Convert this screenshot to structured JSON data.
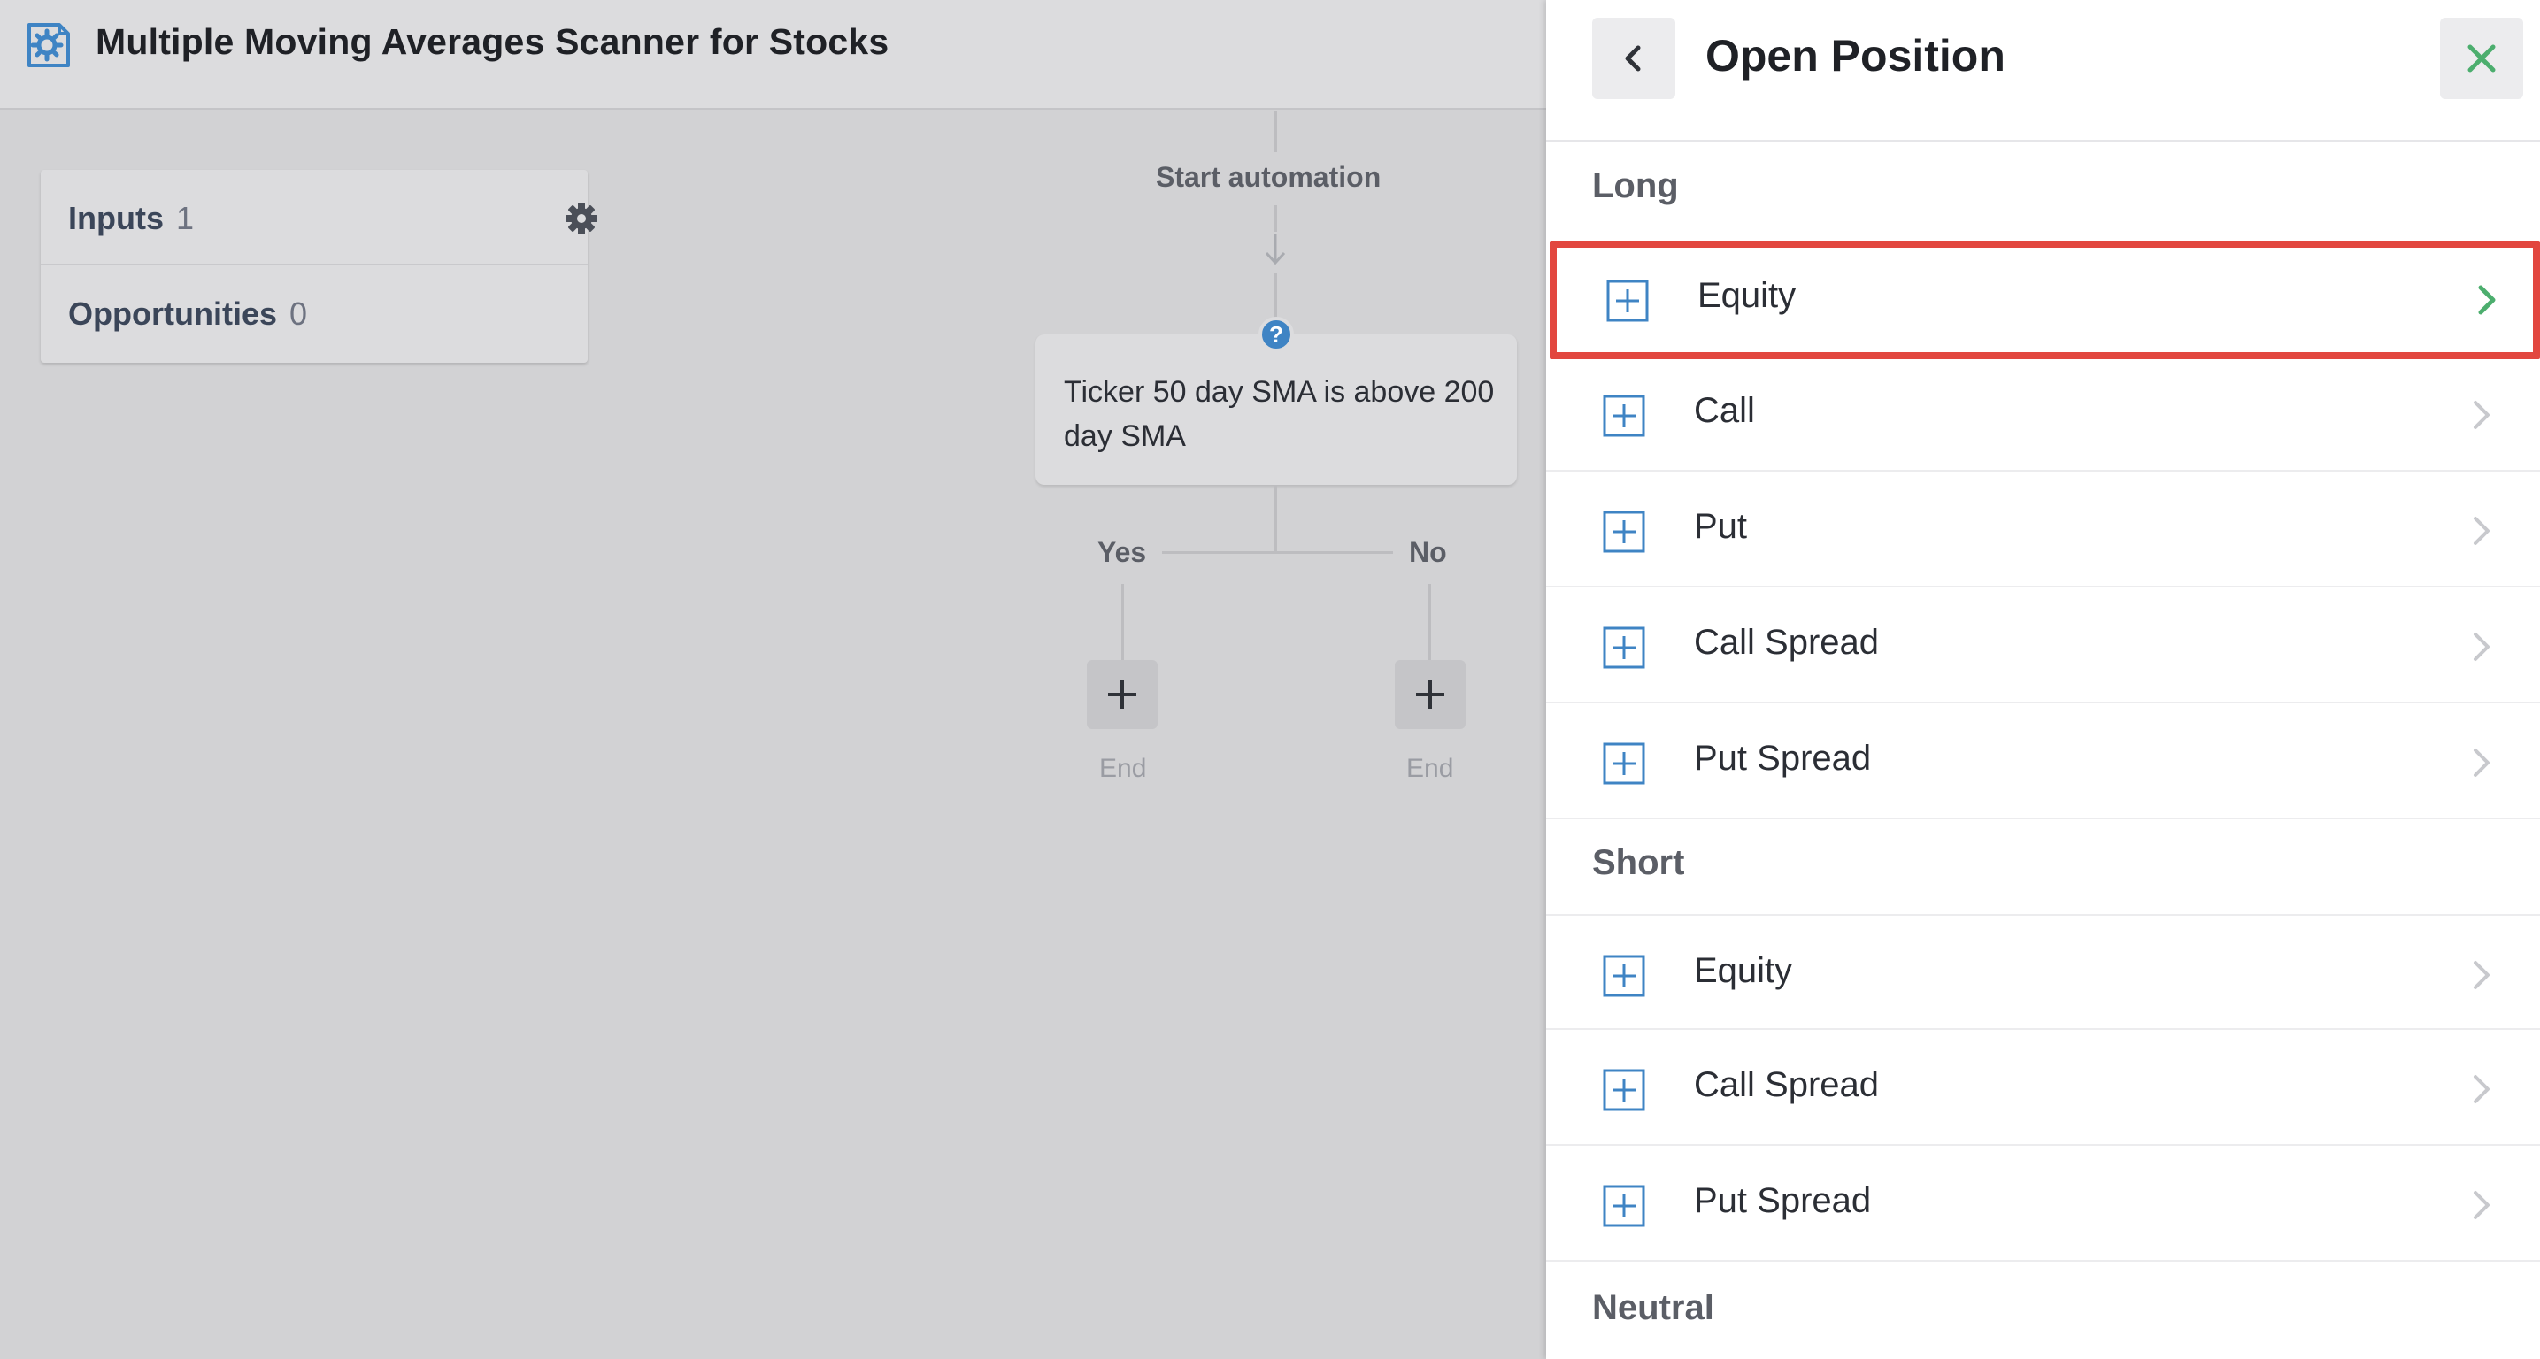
{
  "app": {
    "title": "Multiple Moving Averages Scanner for Stocks"
  },
  "sidebar_card": {
    "inputs_label": "Inputs",
    "inputs_count": "1",
    "opportunities_label": "Opportunities",
    "opportunities_count": "0"
  },
  "flow": {
    "start_label": "Start automation",
    "condition_text": "Ticker 50 day SMA is above 200 day SMA",
    "condition_icon": "question-icon",
    "yes_label": "Yes",
    "no_label": "No",
    "yes_end_label": "End",
    "no_end_label": "End"
  },
  "panel": {
    "title": "Open Position",
    "sections": [
      {
        "heading": "Long",
        "items": [
          {
            "label": "Equity",
            "selected": true
          },
          {
            "label": "Call"
          },
          {
            "label": "Put"
          },
          {
            "label": "Call Spread"
          },
          {
            "label": "Put Spread"
          }
        ]
      },
      {
        "heading": "Short",
        "items": [
          {
            "label": "Equity"
          },
          {
            "label": "Call Spread"
          },
          {
            "label": "Put Spread"
          }
        ]
      },
      {
        "heading": "Neutral",
        "items": []
      }
    ]
  },
  "colors": {
    "accent_green": "#4cae6e",
    "icon_blue": "#3f84c4",
    "highlight_red": "#e2473f"
  }
}
